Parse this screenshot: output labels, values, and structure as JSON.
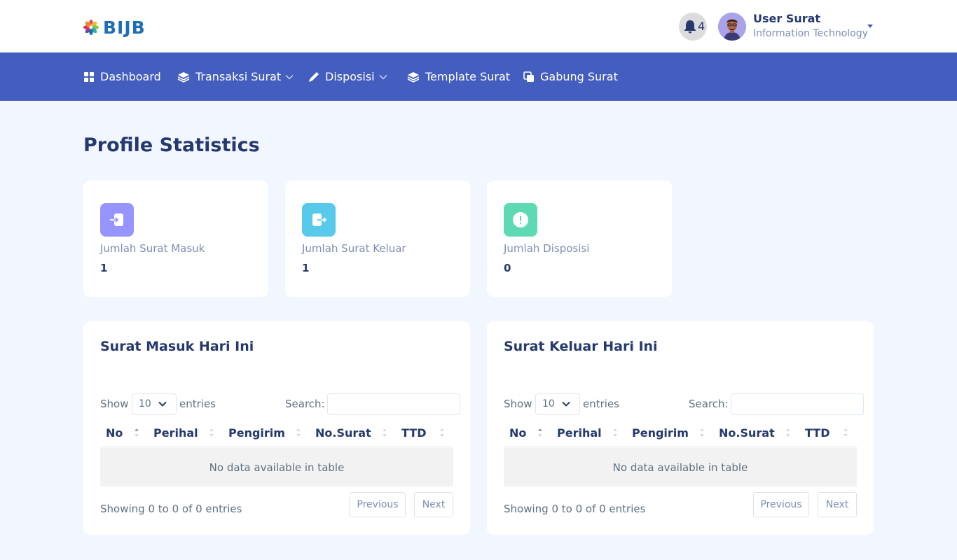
{
  "brand": {
    "name": "BIJB"
  },
  "header": {
    "notifications_count": "4",
    "user": {
      "name": "User Surat",
      "department": "Information Technology"
    }
  },
  "nav": {
    "items": [
      {
        "label": "Dashboard",
        "icon": "grid-icon",
        "has_dropdown": false
      },
      {
        "label": "Transaksi Surat",
        "icon": "stack-icon",
        "has_dropdown": true
      },
      {
        "label": "Disposisi",
        "icon": "pen-icon",
        "has_dropdown": true
      },
      {
        "label": "Template Surat",
        "icon": "stack-icon",
        "has_dropdown": false
      },
      {
        "label": "Gabung Surat",
        "icon": "copy-icon",
        "has_dropdown": false
      }
    ]
  },
  "page": {
    "title": "Profile Statistics"
  },
  "stats": [
    {
      "label": "Jumlah Surat Masuk",
      "value": "1",
      "icon": "login-icon",
      "color": "#9694ff"
    },
    {
      "label": "Jumlah Surat Keluar",
      "value": "1",
      "icon": "logout-icon",
      "color": "#57caeb"
    },
    {
      "label": "Jumlah Disposisi",
      "value": "0",
      "icon": "alert-icon",
      "color": "#5ddab4"
    }
  ],
  "tables": [
    {
      "title": "Surat Masuk Hari Ini",
      "show_label": "Show",
      "entries_value": "10",
      "entries_label": "entries",
      "search_label": "Search:",
      "search_value": "",
      "columns": [
        "No",
        "Perihal",
        "Pengirim",
        "No.Surat",
        "TTD"
      ],
      "empty_text": "No data available in table",
      "info": "Showing 0 to 0 of 0 entries",
      "prev_label": "Previous",
      "next_label": "Next"
    },
    {
      "title": "Surat Keluar Hari Ini",
      "show_label": "Show",
      "entries_value": "10",
      "entries_label": "entries",
      "search_label": "Search:",
      "search_value": "",
      "columns": [
        "No",
        "Perihal",
        "Pengirim",
        "No.Surat",
        "TTD"
      ],
      "empty_text": "No data available in table",
      "info": "Showing 0 to 0 of 0 entries",
      "prev_label": "Previous",
      "next_label": "Next"
    }
  ],
  "colors": {
    "primary": "#435ebe",
    "heading": "#25396f",
    "muted": "#7c8db5",
    "background": "#f2f7ff"
  }
}
